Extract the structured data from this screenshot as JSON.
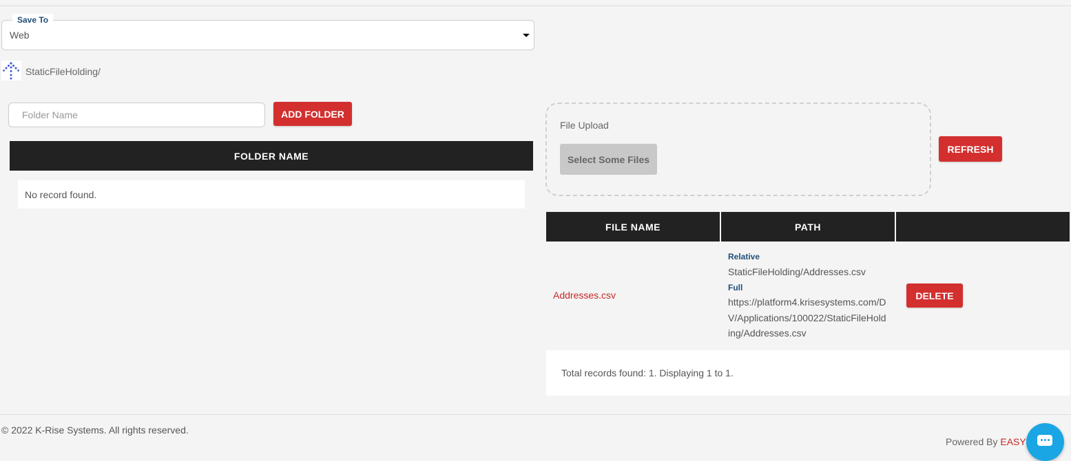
{
  "save_to": {
    "label": "Save To",
    "value": "Web"
  },
  "path": {
    "current": "StaticFileHolding/"
  },
  "folder": {
    "input_placeholder": "Folder Name",
    "add_button": "ADD FOLDER",
    "table_header": "FOLDER NAME",
    "empty_message": "No record found."
  },
  "upload": {
    "label": "File Upload",
    "select_button": "Select Some Files",
    "refresh_button": "REFRESH"
  },
  "files": {
    "headers": [
      "FILE NAME",
      "PATH",
      ""
    ],
    "rows": [
      {
        "name": "Addresses.csv",
        "relative_label": "Relative",
        "relative_path": "StaticFileHolding/Addresses.csv",
        "full_label": "Full",
        "full_path": "https://platform4.krisesystems.com/DV/Applications/100022/StaticFileHolding/Addresses.csv",
        "delete_button": "DELETE"
      }
    ],
    "summary": "Total records found: 1. Displaying 1 to 1."
  },
  "footer": {
    "copyright": "© 2022 K-Rise Systems. All rights reserved.",
    "powered_by": "Powered By",
    "brand": "EASY"
  },
  "colors": {
    "accent_red": "#d32f2f",
    "header_dark": "#222222",
    "label_blue": "#1f4e79",
    "chat_blue": "#1aa6e4"
  }
}
